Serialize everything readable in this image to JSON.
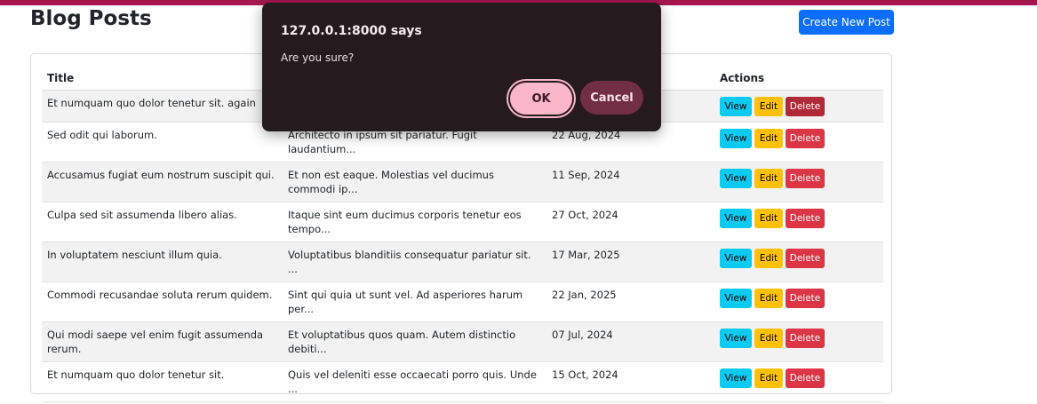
{
  "page": {
    "title": "Blog Posts",
    "create_button": "Create New Post",
    "accent_bar_color": "#a6174f"
  },
  "table": {
    "headers": [
      "Title",
      "",
      "",
      "Actions"
    ],
    "action_labels": {
      "view": "View",
      "edit": "Edit",
      "delete": "Delete"
    },
    "rows": [
      {
        "title": "Et numquam quo dolor tenetur sit. again",
        "excerpt": "",
        "date": ""
      },
      {
        "title": "Sed odit qui laborum.",
        "excerpt": "Architecto in ipsum sit pariatur. Fugit laudantium...",
        "date": "22 Aug, 2024"
      },
      {
        "title": "Accusamus fugiat eum nostrum suscipit qui.",
        "excerpt": "Et non est eaque. Molestias vel ducimus commodi ip...",
        "date": "11 Sep, 2024"
      },
      {
        "title": "Culpa sed sit assumenda libero alias.",
        "excerpt": "Itaque sint eum ducimus corporis tenetur eos tempo...",
        "date": "27 Oct, 2024"
      },
      {
        "title": "In voluptatem nesciunt illum quia.",
        "excerpt": "Voluptatibus blanditiis consequatur pariatur sit. ...",
        "date": "17 Mar, 2025"
      },
      {
        "title": "Commodi recusandae soluta rerum quidem.",
        "excerpt": "Sint qui quia ut sunt vel. Ad asperiores harum per...",
        "date": "22 Jan, 2025"
      },
      {
        "title": "Qui modi saepe vel enim fugit assumenda rerum.",
        "excerpt": "Et voluptatibus quos quam. Autem distinctio debiti...",
        "date": "07 Jul, 2024"
      },
      {
        "title": "Et numquam quo dolor tenetur sit.",
        "excerpt": "Quis vel deleniti esse occaecati porro quis. Unde ...",
        "date": "15 Oct, 2024"
      }
    ]
  },
  "dialog": {
    "title": "127.0.0.1:8000 says",
    "message": "Are you sure?",
    "ok": "OK",
    "cancel": "Cancel"
  }
}
